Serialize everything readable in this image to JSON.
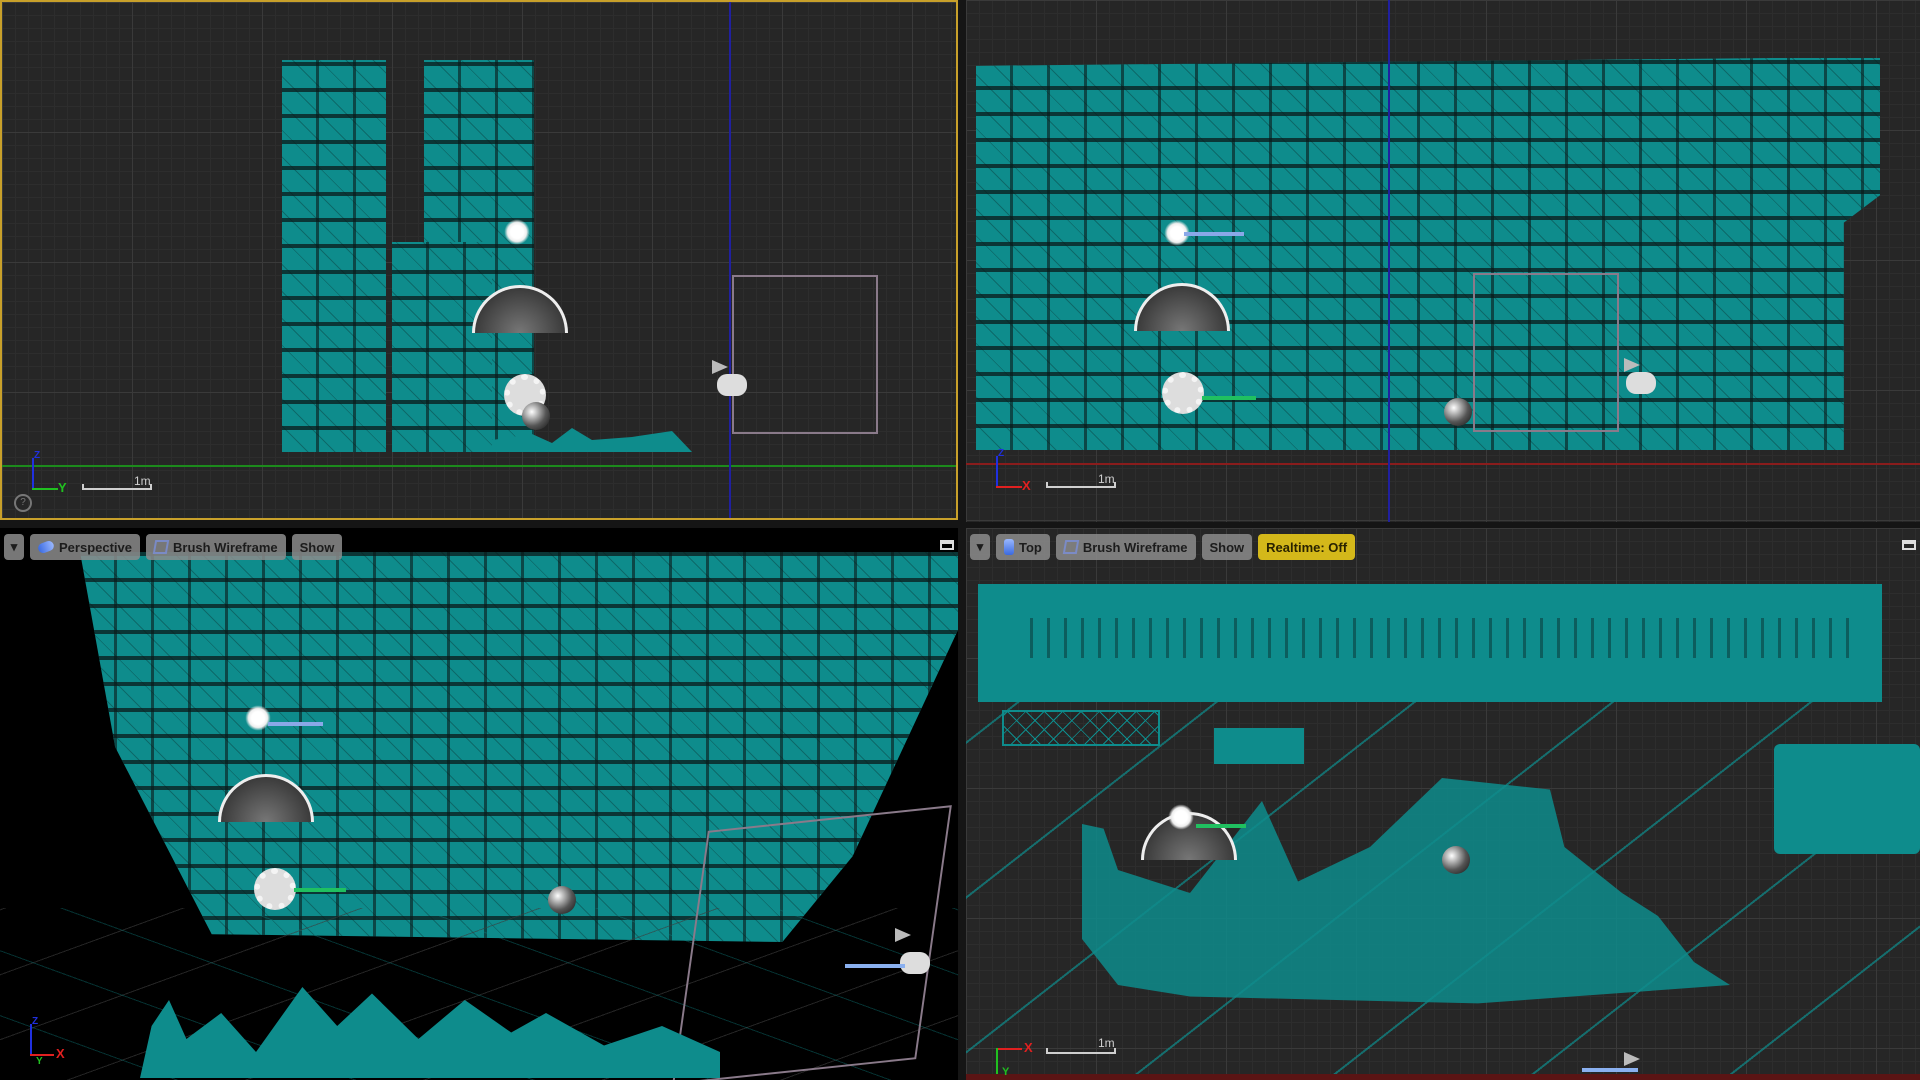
{
  "viewports": {
    "top_left": {
      "projection": "Side",
      "active": true,
      "axes": {
        "vertical": "Z",
        "horizontal": "Y"
      },
      "scale_label": "1m",
      "help_icon": "?"
    },
    "top_right": {
      "projection": "Front",
      "axes": {
        "vertical": "Z",
        "horizontal": "X"
      },
      "scale_label": "1m"
    },
    "bottom_left": {
      "toolbar": {
        "menu_caret": "▾",
        "view_mode_label": "Perspective",
        "render_mode_label": "Brush Wireframe",
        "show_label": "Show"
      },
      "axes": {
        "vertical": "Z",
        "horizontal": "X",
        "depth": "Y"
      }
    },
    "bottom_right": {
      "toolbar": {
        "menu_caret": "▾",
        "view_mode_label": "Top",
        "render_mode_label": "Brush Wireframe",
        "show_label": "Show",
        "realtime_label": "Realtime: Off"
      },
      "axes": {
        "horizontal": "X",
        "vertical": "Y"
      },
      "scale_label": "1m"
    }
  },
  "colors": {
    "geometry": "#0e8c8c",
    "active_border": "#c8a02a",
    "realtime_badge": "#d4b81a",
    "axis_x": "#e02020",
    "axis_y": "#20c020",
    "axis_z": "#2030e0"
  },
  "scene_icons": [
    "sun-light-icon",
    "sky-light-icon",
    "player-start-icon",
    "reflection-sphere-icon",
    "game-controller-icon",
    "flag-icon"
  ]
}
